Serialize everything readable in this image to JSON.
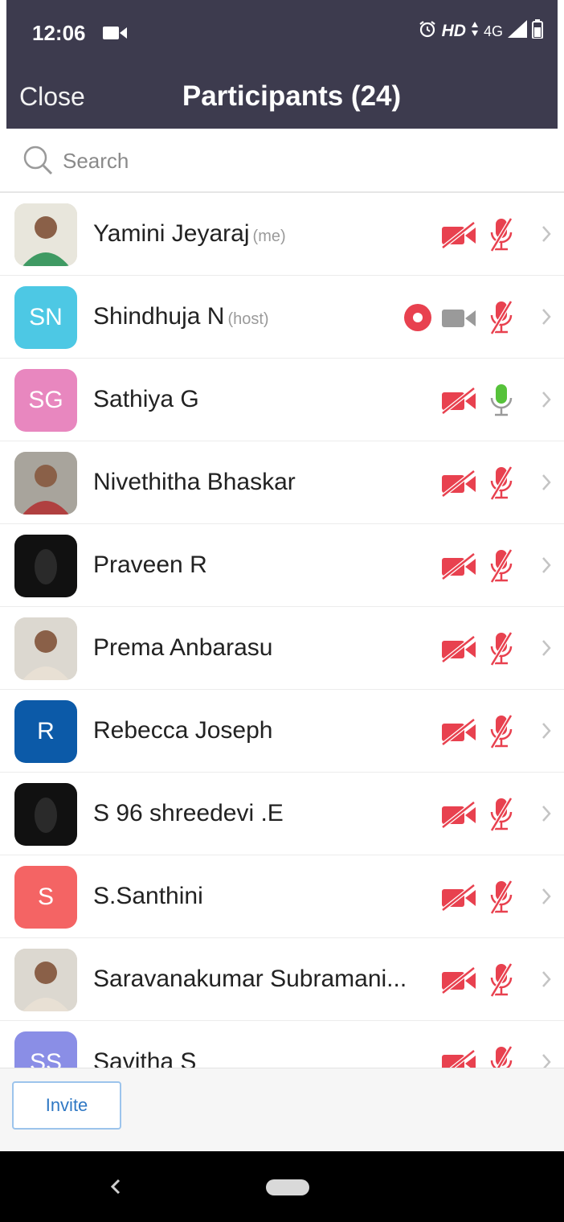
{
  "status_bar": {
    "time": "12:06",
    "hd": "HD",
    "network": "4G"
  },
  "header": {
    "close_label": "Close",
    "title": "Participants (24)"
  },
  "search": {
    "placeholder": "Search"
  },
  "participants": [
    {
      "name": "Yamini Jeyaraj",
      "tag": "(me)",
      "avatar": "photo",
      "video": "off",
      "audio": "muted"
    },
    {
      "name": "Shindhuja N",
      "tag": "(host)",
      "initials": "SN",
      "avatar_color": "#4dc8e4",
      "recording": true,
      "video": "on",
      "audio": "muted"
    },
    {
      "name": "Sathiya G",
      "initials": "SG",
      "avatar_color": "#e887bf",
      "video": "off",
      "audio": "active"
    },
    {
      "name": "Nivethitha Bhaskar",
      "avatar": "photo",
      "video": "off",
      "audio": "muted"
    },
    {
      "name": "Praveen R",
      "avatar": "photo-dark",
      "video": "off",
      "audio": "muted"
    },
    {
      "name": "Prema Anbarasu",
      "avatar": "photo",
      "video": "off",
      "audio": "muted"
    },
    {
      "name": "Rebecca Joseph",
      "initials": "R",
      "avatar_color": "#0c5aa8",
      "video": "off",
      "audio": "muted"
    },
    {
      "name": "S 96 shreedevi .E",
      "avatar": "photo-dark",
      "video": "off",
      "audio": "muted"
    },
    {
      "name": "S.Santhini",
      "initials": "S",
      "avatar_color": "#f46464",
      "video": "off",
      "audio": "muted"
    },
    {
      "name": "Saravanakumar Subramani...",
      "avatar": "photo",
      "video": "off",
      "audio": "muted"
    },
    {
      "name": "Savitha S",
      "initials": "SS",
      "avatar_color": "#8a8ee6",
      "video": "off",
      "audio": "muted"
    }
  ],
  "footer": {
    "invite_label": "Invite"
  },
  "colors": {
    "header_bg": "#3d3b4e",
    "muted_red": "#e8414f",
    "active_green": "#56c23a",
    "record_red": "#e8414f",
    "video_gray": "#9a9a9a"
  },
  "icons": {
    "search": "magnifier-icon",
    "video_off": "video-off-icon",
    "video_on": "video-camera-icon",
    "mic_muted": "mic-muted-icon",
    "mic_active": "mic-icon",
    "recording": "record-icon",
    "chevron": "chevron-right-icon"
  }
}
